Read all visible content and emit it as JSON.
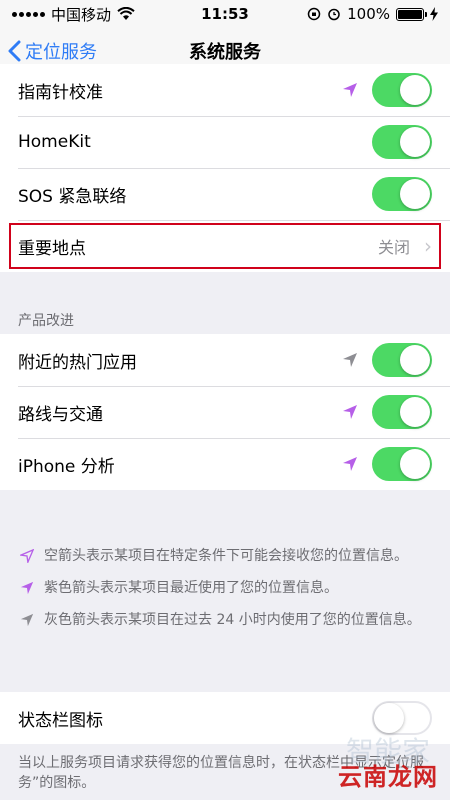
{
  "status_bar": {
    "carrier": "中国移动",
    "time": "11:53",
    "battery": "100%"
  },
  "nav": {
    "back_label": "定位服务",
    "title": "系统服务"
  },
  "group1": {
    "rows": [
      {
        "label": "指南针校准",
        "arrow": "purple",
        "toggle": true
      },
      {
        "label": "HomeKit",
        "arrow": "none",
        "toggle": true
      },
      {
        "label": "SOS 紧急联络",
        "arrow": "none",
        "toggle": true
      },
      {
        "label": "重要地点",
        "value": "关闭"
      }
    ]
  },
  "section2": {
    "header": "产品改进",
    "rows": [
      {
        "label": "附近的热门应用",
        "arrow": "gray",
        "toggle": true
      },
      {
        "label": "路线与交通",
        "arrow": "purple",
        "toggle": true
      },
      {
        "label": "iPhone 分析",
        "arrow": "purple",
        "toggle": true
      }
    ]
  },
  "legend": {
    "hollow": "空箭头表示某项目在特定条件下可能会接收您的位置信息。",
    "purple": "紫色箭头表示某项目最近使用了您的位置信息。",
    "gray": "灰色箭头表示某项目在过去 24 小时内使用了您的位置信息。"
  },
  "group3": {
    "label": "状态栏图标",
    "toggle": false
  },
  "footer": {
    "text": "当以上服务项目请求获得您的位置信息时，在状态栏中显示定位服务”的图标。"
  },
  "watermark": {
    "main": "云南龙网",
    "bg": "智能家"
  },
  "colors": {
    "accent": "#2f7cf6",
    "toggle_on": "#4cd964",
    "purple_arrow": "#b65fe8",
    "gray_arrow": "#8e8e93",
    "highlight_border": "#d0021b"
  }
}
